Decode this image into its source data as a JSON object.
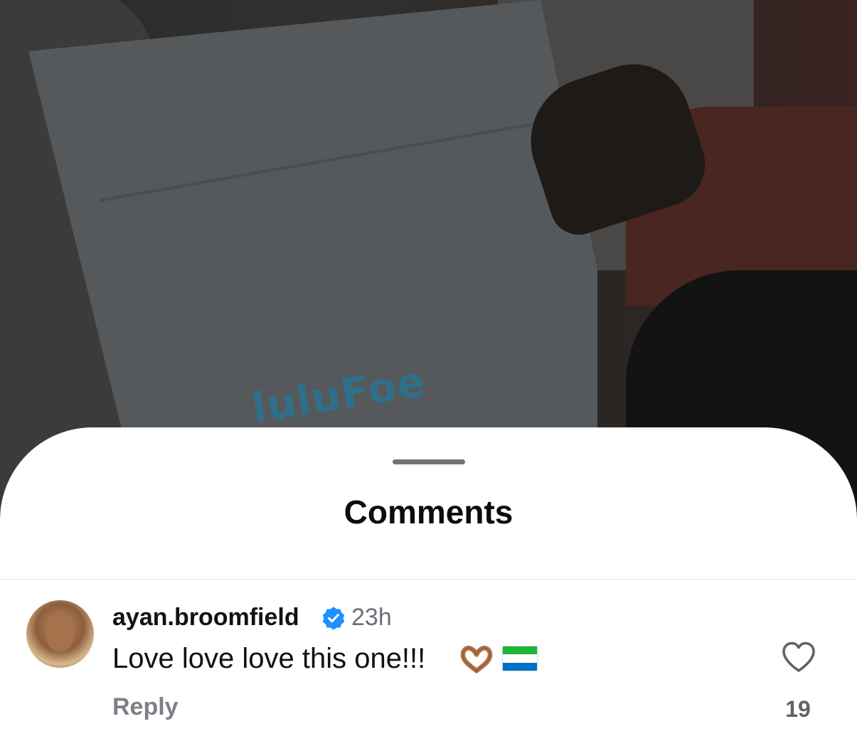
{
  "background_photo": {
    "book_logo_text": "luluFoe",
    "dimmed": true
  },
  "sheet": {
    "title": "Comments"
  },
  "comments": [
    {
      "username": "ayan.broomfield",
      "verified": true,
      "timestamp": "23h",
      "text": "Love love love this one!!!",
      "emojis": [
        "heart-hands-emoji",
        "sierra-leone-flag-emoji"
      ],
      "reply_label": "Reply",
      "like_count": "19",
      "liked": false
    }
  ],
  "colors": {
    "verified_blue": "#1e90ff",
    "sheet_background": "#ffffff",
    "secondary_text": "#7c8086",
    "flag_green": "#1eb53a",
    "flag_blue": "#0072c6"
  }
}
